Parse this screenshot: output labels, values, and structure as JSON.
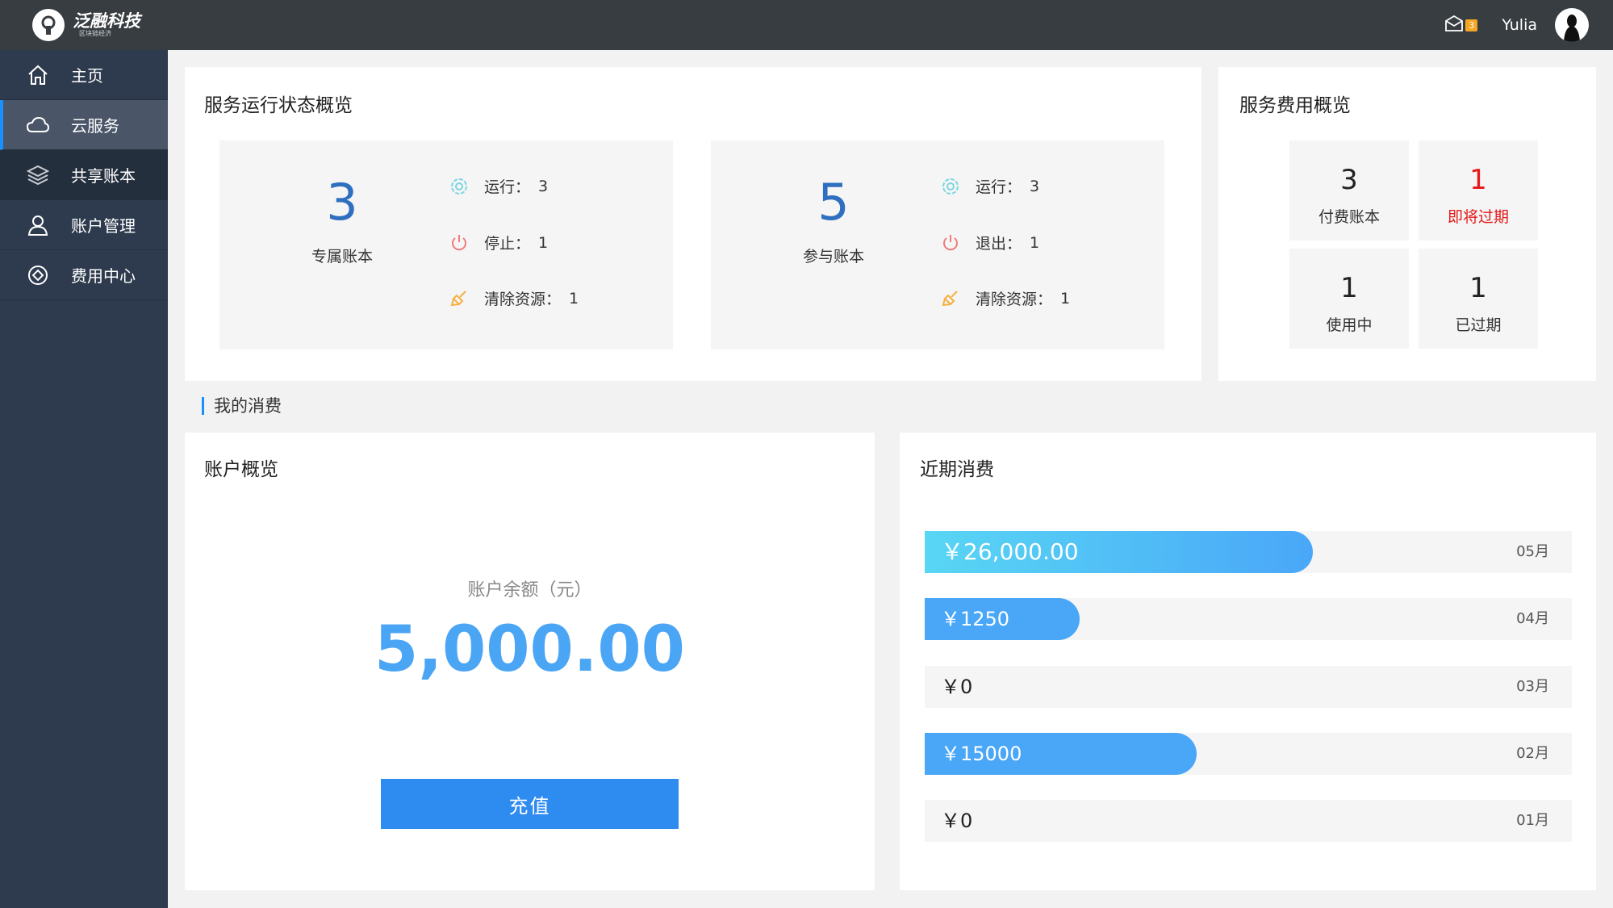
{
  "header": {
    "brand_name": "泛融科技",
    "brand_sub": "区块链经济",
    "mail_count": "3",
    "username": "Yulia"
  },
  "sidebar": {
    "items": [
      {
        "label": "主页",
        "icon": "home-icon"
      },
      {
        "label": "云服务",
        "icon": "cloud-icon"
      },
      {
        "label": "共享账本",
        "icon": "layers-icon"
      },
      {
        "label": "账户管理",
        "icon": "user-icon"
      },
      {
        "label": "费用中心",
        "icon": "cost-icon"
      }
    ]
  },
  "service_status": {
    "title": "服务运行状态概览",
    "dedicated": {
      "count": "3",
      "label": "专属账本",
      "lines": [
        {
          "label": "运行：",
          "value": "3"
        },
        {
          "label": "停止：",
          "value": "1"
        },
        {
          "label": "清除资源：",
          "value": "1"
        }
      ]
    },
    "participating": {
      "count": "5",
      "label": "参与账本",
      "lines": [
        {
          "label": "运行：",
          "value": "3"
        },
        {
          "label": "退出：",
          "value": "1"
        },
        {
          "label": "清除资源：",
          "value": "1"
        }
      ]
    }
  },
  "fee_overview": {
    "title": "服务费用概览",
    "tiles": [
      {
        "value": "3",
        "label": "付费账本"
      },
      {
        "value": "1",
        "label": "即将过期"
      },
      {
        "value": "1",
        "label": "使用中"
      },
      {
        "value": "1",
        "label": "已过期"
      }
    ]
  },
  "my_consumption": {
    "section_label": "我的消费"
  },
  "account": {
    "title": "账户概览",
    "balance_label": "账户余额（元）",
    "balance": "5,000.00",
    "recharge_label": "充值"
  },
  "recent": {
    "title": "近期消费",
    "rows": [
      {
        "amount": "￥26,000.00",
        "month": "05月",
        "fill": 0.6
      },
      {
        "amount": "￥1250",
        "month": "04月",
        "fill": 0.24
      },
      {
        "amount": "￥0",
        "month": "03月",
        "fill": 0
      },
      {
        "amount": "￥15000",
        "month": "02月",
        "fill": 0.42
      },
      {
        "amount": "￥0",
        "month": "01月",
        "fill": 0
      }
    ]
  },
  "colors": {
    "topbar": "#373d41",
    "sidebar": "#2e3b4e",
    "accent": "#1890ff",
    "warning": "#e41a1a"
  }
}
